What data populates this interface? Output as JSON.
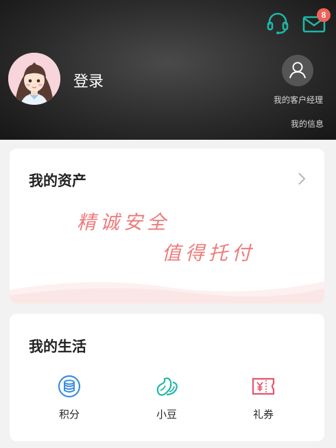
{
  "header": {
    "login_text": "登录",
    "message_badge": "8",
    "manager_label": "我的客户经理",
    "info_label": "我的信息"
  },
  "assets": {
    "title": "我的资产",
    "slogan_line1": "精诚安全",
    "slogan_line2": "值得托付"
  },
  "life": {
    "title": "我的生活",
    "items": [
      {
        "label": "积分",
        "icon": "coin-stack-icon"
      },
      {
        "label": "小豆",
        "icon": "beans-icon"
      },
      {
        "label": "礼券",
        "icon": "voucher-icon"
      }
    ]
  },
  "colors": {
    "teal_icon": "#1fb7a6",
    "badge": "#f0625a",
    "slogan": "#ee7b7b",
    "coin_blue": "#3a8de0",
    "voucher_red": "#e8526b"
  }
}
